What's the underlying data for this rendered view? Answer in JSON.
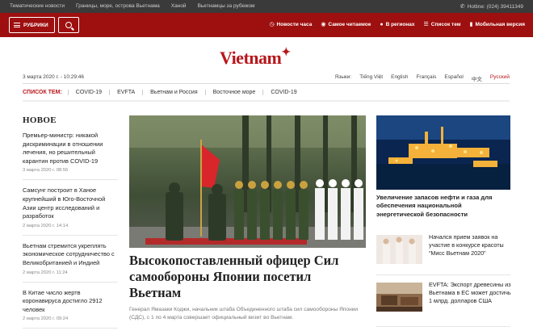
{
  "topbar": {
    "links": [
      "Тематические новости",
      "Границы, море, острова Вьетнама",
      "Ханой",
      "Вьетнамцы за рубежом"
    ],
    "hotline_label": "Hotline: (024) 39411349",
    "icons": {
      "hotline": "phone-icon"
    }
  },
  "nav": {
    "rubriki_label": "РУБРИКИ",
    "items": [
      {
        "label": "Новости часа",
        "icon": "clock-icon"
      },
      {
        "label": "Самое читаемое",
        "icon": "eye-icon"
      },
      {
        "label": "В регионах",
        "icon": "map-pin-icon"
      },
      {
        "label": "Список тем",
        "icon": "list-icon"
      },
      {
        "label": "Мобильная версия",
        "icon": "mobile-icon"
      }
    ]
  },
  "logo": {
    "text": "Vietnam",
    "color": "#b8171c"
  },
  "dateline": "3 марта 2020 г. - 10:29:46",
  "languages": {
    "label": "Языки:",
    "items": [
      "Tiếng Việt",
      "English",
      "Français",
      "Español",
      "中文",
      "Русский"
    ],
    "selected": "Русский"
  },
  "topics": {
    "label": "СПИСОК ТЕМ:",
    "items": [
      "COVID-19",
      "EVFTA",
      "Вьетнам и Россия",
      "Восточное море",
      "COVID-19"
    ]
  },
  "news": {
    "heading": "НОВОЕ",
    "items": [
      {
        "title": "Премьер-министр: никакой дискриминации в отношении лечения, но решительный карантин против COVID-19",
        "date": "3 марта 2020 г. 08:56"
      },
      {
        "title": "Самсунг построит в Ханое крупнейший в Юго-Восточной Азии центр исследований и разработок",
        "date": "2 марта 2020 г. 14:14"
      },
      {
        "title": "Вьетнам стремится укреплять экономическое сотрудничество с Великобританией и Индией",
        "date": "2 марта 2020 г. 11:24"
      },
      {
        "title": "В Китае число жертв коронавируса достигло 2912 человек",
        "date": "2 марта 2020 г. 09:24"
      }
    ]
  },
  "main": {
    "headline": "Высокопоставленный офицер Сил самообороны Японии посетил Вьетнам",
    "lead": "Генерал Ямазаки Коджи, начальник штаба Объединенного штаба сил самообороны Японии (СДС), с 1 по 4 марта совершает официальный визит во Вьетнам."
  },
  "right": {
    "feature_title": "Увеличение запасов нефти и газа для обеспечения национальной энергетической безопасности",
    "items": [
      {
        "title": "Начался прием заявок на участие в конкурсе красоты “Мисс Вьетнам 2020”"
      },
      {
        "title": "EVFTA: Экспорт древесины из Вьетнама в ЕС может достичь 1 млрд. долларов США"
      }
    ]
  }
}
